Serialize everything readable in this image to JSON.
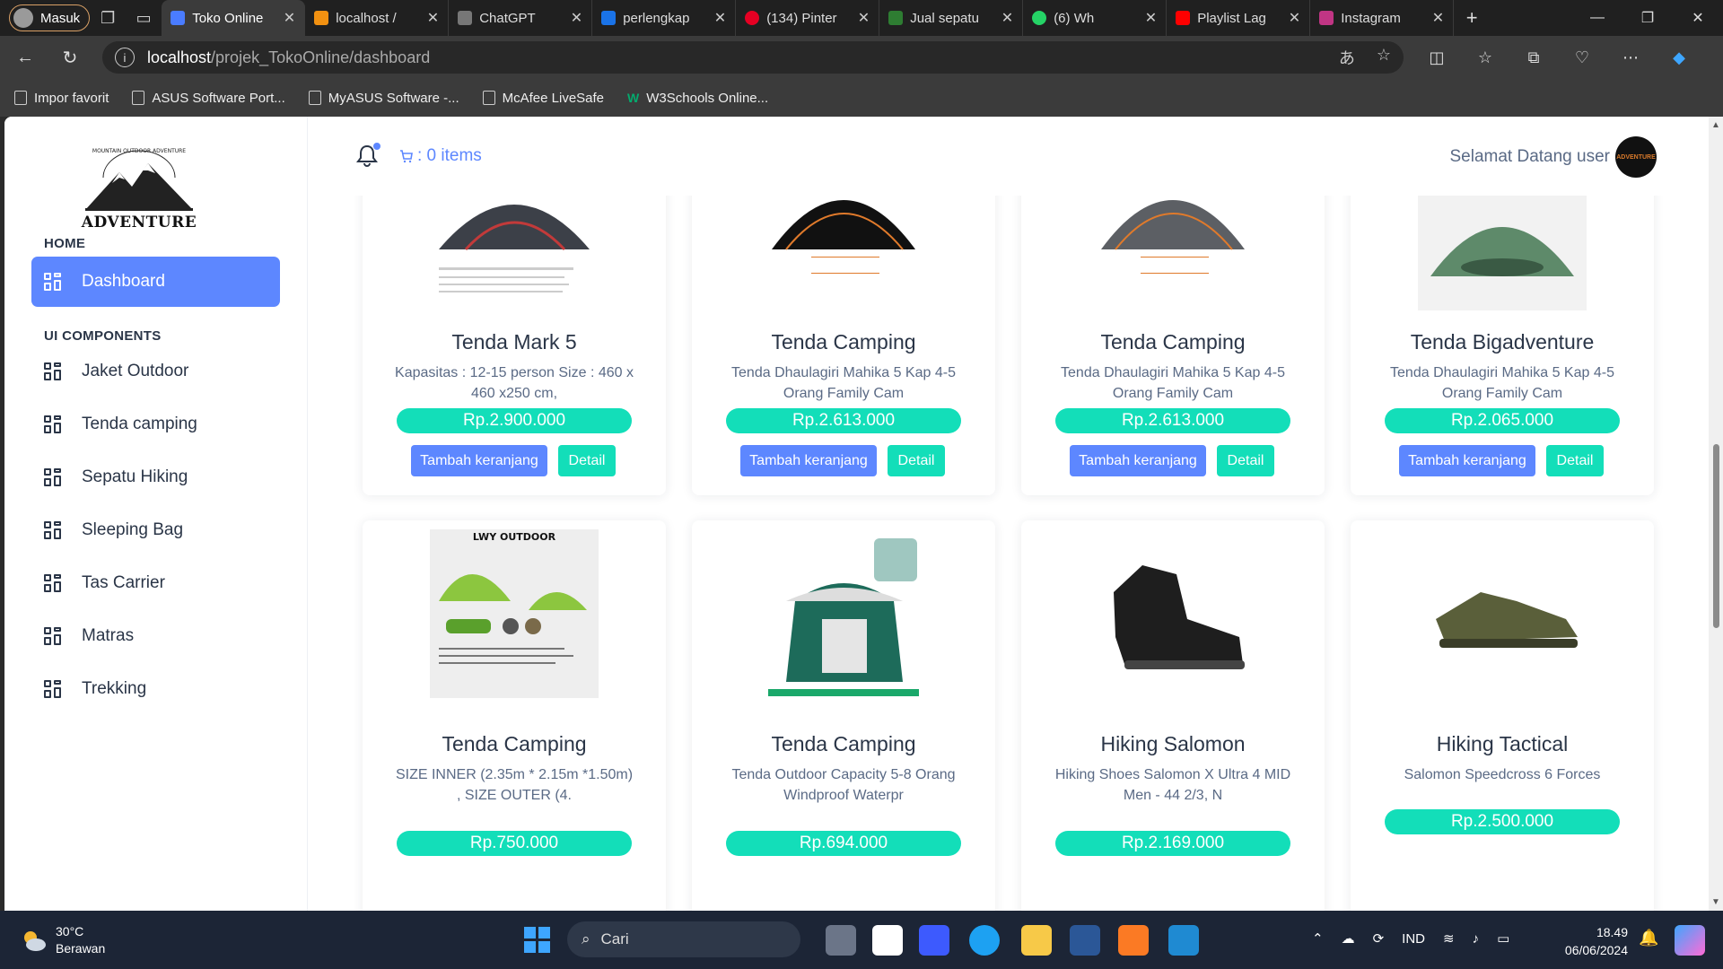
{
  "browser": {
    "profile_label": "Masuk",
    "tabs": [
      {
        "title": "Toko Online",
        "color": "#4a7cff"
      },
      {
        "title": "localhost /",
        "color": "#f29111"
      },
      {
        "title": "ChatGPT",
        "color": "#ffffff"
      },
      {
        "title": "perlengkap",
        "color": "#1a73e8"
      },
      {
        "title": "(134) Pinter",
        "color": "#e60023"
      },
      {
        "title": "Jual sepatu",
        "color": "#2e7d32"
      },
      {
        "title": "(6) Wh",
        "color": "#25d366"
      },
      {
        "title": "Playlist Lag",
        "color": "#ff0000"
      },
      {
        "title": "Instagram",
        "color": "#c13584"
      }
    ],
    "url_host": "localhost",
    "url_path": "/projek_TokoOnline/dashboard",
    "bookmarks": [
      "Impor favorit",
      "ASUS Software Port...",
      "MyASUS Software -...",
      "McAfee LiveSafe",
      "W3Schools Online..."
    ]
  },
  "sidebar": {
    "logo_text": "ADVENTURE",
    "logo_arc_text": "MOUNTAIN OUTDOOR ADVENTURE",
    "section_home": "HOME",
    "section_ui": "UI COMPONENTS",
    "dashboard": "Dashboard",
    "items": [
      "Jaket Outdoor",
      "Tenda camping",
      "Sepatu Hiking",
      "Sleeping Bag",
      "Tas Carrier",
      "Matras",
      "Trekking"
    ]
  },
  "header": {
    "cart_label": ": 0 items",
    "welcome": "Selamat Datang user",
    "avatar_text": "ADVENTURE"
  },
  "products_row1": [
    {
      "title": "Tenda Mark 5",
      "desc": "Kapasitas : 12-15 person Size : 460 x 460 x250 cm,",
      "price": "Rp.2.900.000"
    },
    {
      "title": "Tenda Camping",
      "desc": "Tenda Dhaulagiri Mahika 5 Kap 4-5 Orang Family Cam",
      "price": "Rp.2.613.000"
    },
    {
      "title": "Tenda Camping",
      "desc": "Tenda Dhaulagiri Mahika 5 Kap 4-5 Orang Family Cam",
      "price": "Rp.2.613.000"
    },
    {
      "title": "Tenda Bigadventure",
      "desc": "Tenda Dhaulagiri Mahika 5 Kap 4-5 Orang Family Cam",
      "price": "Rp.2.065.000"
    }
  ],
  "products_row2": [
    {
      "title": "Tenda Camping",
      "desc": "SIZE INNER (2.35m * 2.15m *1.50m) , SIZE OUTER (4.",
      "price": "Rp.750.000",
      "img_text": "LWY OUTDOOR"
    },
    {
      "title": "Tenda Camping",
      "desc": "Tenda Outdoor Capacity 5-8 Orang Windproof Waterpr",
      "price": "Rp.694.000"
    },
    {
      "title": "Hiking Salomon",
      "desc": "Hiking Shoes Salomon X Ultra 4 MID Men - 44 2/3, N",
      "price": "Rp.2.169.000"
    },
    {
      "title": "Hiking Tactical",
      "desc": "Salomon Speedcross 6 Forces",
      "price": "Rp.2.500.000"
    }
  ],
  "buttons": {
    "add_to_cart": "Tambah keranjang",
    "detail": "Detail"
  },
  "taskbar": {
    "temp": "30°C",
    "weather": "Berawan",
    "search": "Cari",
    "lang": "IND",
    "time": "18.49",
    "date": "06/06/2024"
  }
}
